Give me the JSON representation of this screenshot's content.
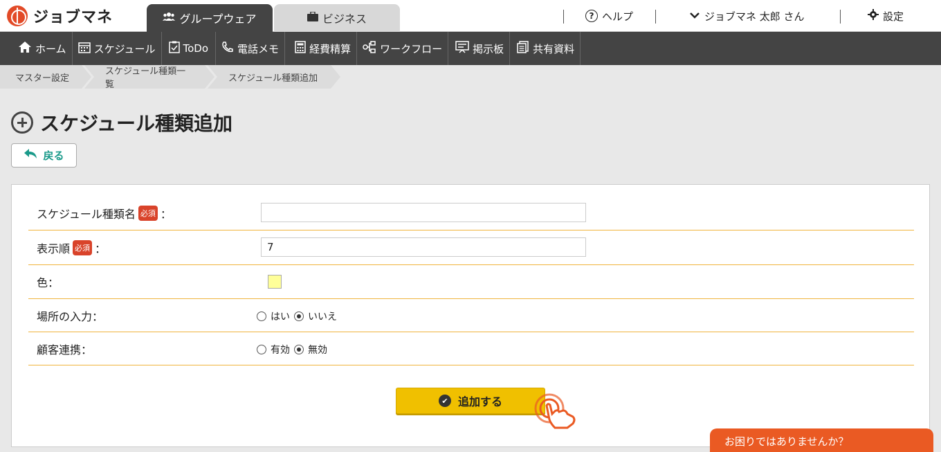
{
  "app": {
    "name": "ジョブマネ"
  },
  "tabs": [
    {
      "label": "グループウェア",
      "icon": "users-icon",
      "active": true
    },
    {
      "label": "ビジネス",
      "icon": "briefcase-icon",
      "active": false
    }
  ],
  "header": {
    "help_label": "ヘルプ",
    "user_label": "ジョブマネ 太郎 さん",
    "settings_label": "設定"
  },
  "nav": [
    {
      "label": "ホーム",
      "icon": "home-icon"
    },
    {
      "label": "スケジュール",
      "icon": "calendar-icon"
    },
    {
      "label": "ToDo",
      "icon": "clipboard-check-icon"
    },
    {
      "label": "電話メモ",
      "icon": "phone-icon"
    },
    {
      "label": "経費精算",
      "icon": "calculator-icon"
    },
    {
      "label": "ワークフロー",
      "icon": "workflow-icon"
    },
    {
      "label": "掲示板",
      "icon": "board-icon"
    },
    {
      "label": "共有資料",
      "icon": "documents-icon"
    }
  ],
  "breadcrumb": [
    "マスター設定",
    "スケジュール種類一覧",
    "スケジュール種類追加"
  ],
  "page": {
    "title": "スケジュール種類追加",
    "back_label": "戻る"
  },
  "form": {
    "required_badge": "必須",
    "colon": "：",
    "name_label": "スケジュール種類名",
    "name_value": "",
    "order_label": "表示順",
    "order_value": "7",
    "color_label": "色：",
    "color_value": "#ffff99",
    "location_label": "場所の入力：",
    "location_options": [
      "はい",
      "いいえ"
    ],
    "location_selected": "いいえ",
    "customer_label": "顧客連携：",
    "customer_options": [
      "有効",
      "無効"
    ],
    "customer_selected": "無効",
    "submit_label": "追加する"
  },
  "support": {
    "label": "お困りではありませんか？"
  },
  "colors": {
    "accent": "#f0c000",
    "required": "#d9432a",
    "chat": "#ea5a23",
    "nav": "#444444",
    "back_text": "#1a9a8a"
  }
}
